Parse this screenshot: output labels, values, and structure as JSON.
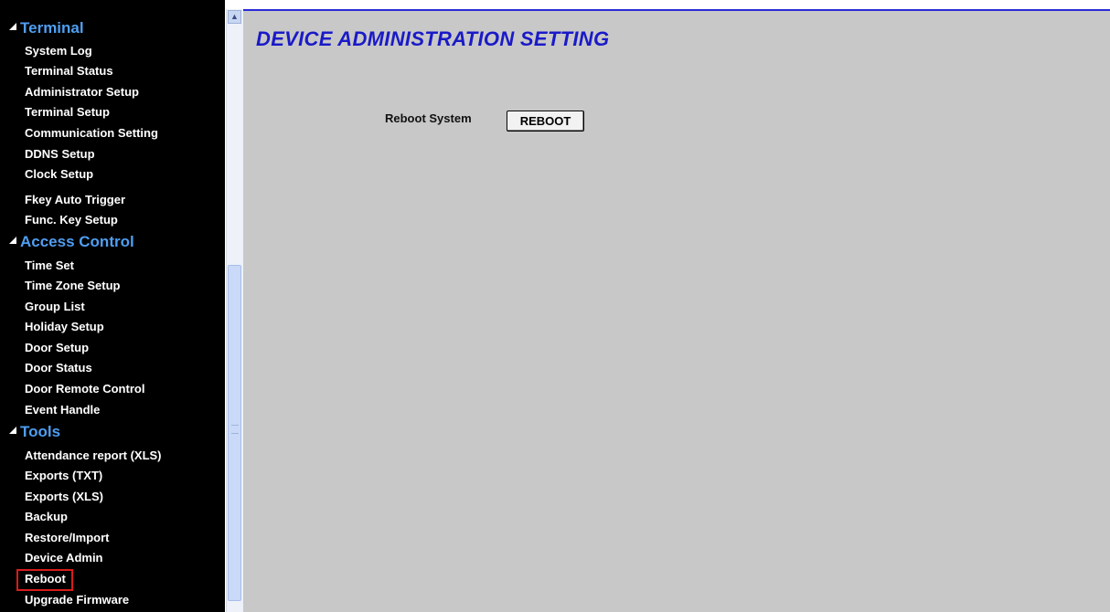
{
  "sidebar": {
    "sections": [
      {
        "label": "Terminal",
        "items": [
          "System Log",
          "Terminal Status",
          "Administrator Setup",
          "Terminal Setup",
          "Communication Setting",
          "DDNS Setup",
          "Clock Setup",
          "Fkey Auto Trigger",
          "Func. Key Setup"
        ]
      },
      {
        "label": "Access Control",
        "items": [
          "Time Set",
          "Time Zone Setup",
          "Group List",
          "Holiday Setup",
          "Door Setup",
          "Door Status",
          "Door Remote Control",
          "Event Handle"
        ]
      },
      {
        "label": "Tools",
        "items": [
          "Attendance report (XLS)",
          "Exports (TXT)",
          "Exports (XLS)",
          "Backup",
          "Restore/Import",
          "Device Admin",
          "Reboot",
          "Upgrade Firmware"
        ]
      }
    ],
    "highlighted_item": "Reboot"
  },
  "main": {
    "title": "DEVICE ADMINISTRATION SETTING",
    "reboot_label": "Reboot System",
    "reboot_button": "REBOOT"
  },
  "colors": {
    "sidebar_bg": "#000000",
    "section_header": "#4f9ef2",
    "nav_text": "#ffffff",
    "main_bg": "#c8c8c8",
    "title": "#1a1ac8",
    "highlight_box": "#d81c1c"
  },
  "icons": {
    "section_toggle": "expanded-triangle-icon",
    "scroll_up": "scroll-up-arrow-icon"
  }
}
